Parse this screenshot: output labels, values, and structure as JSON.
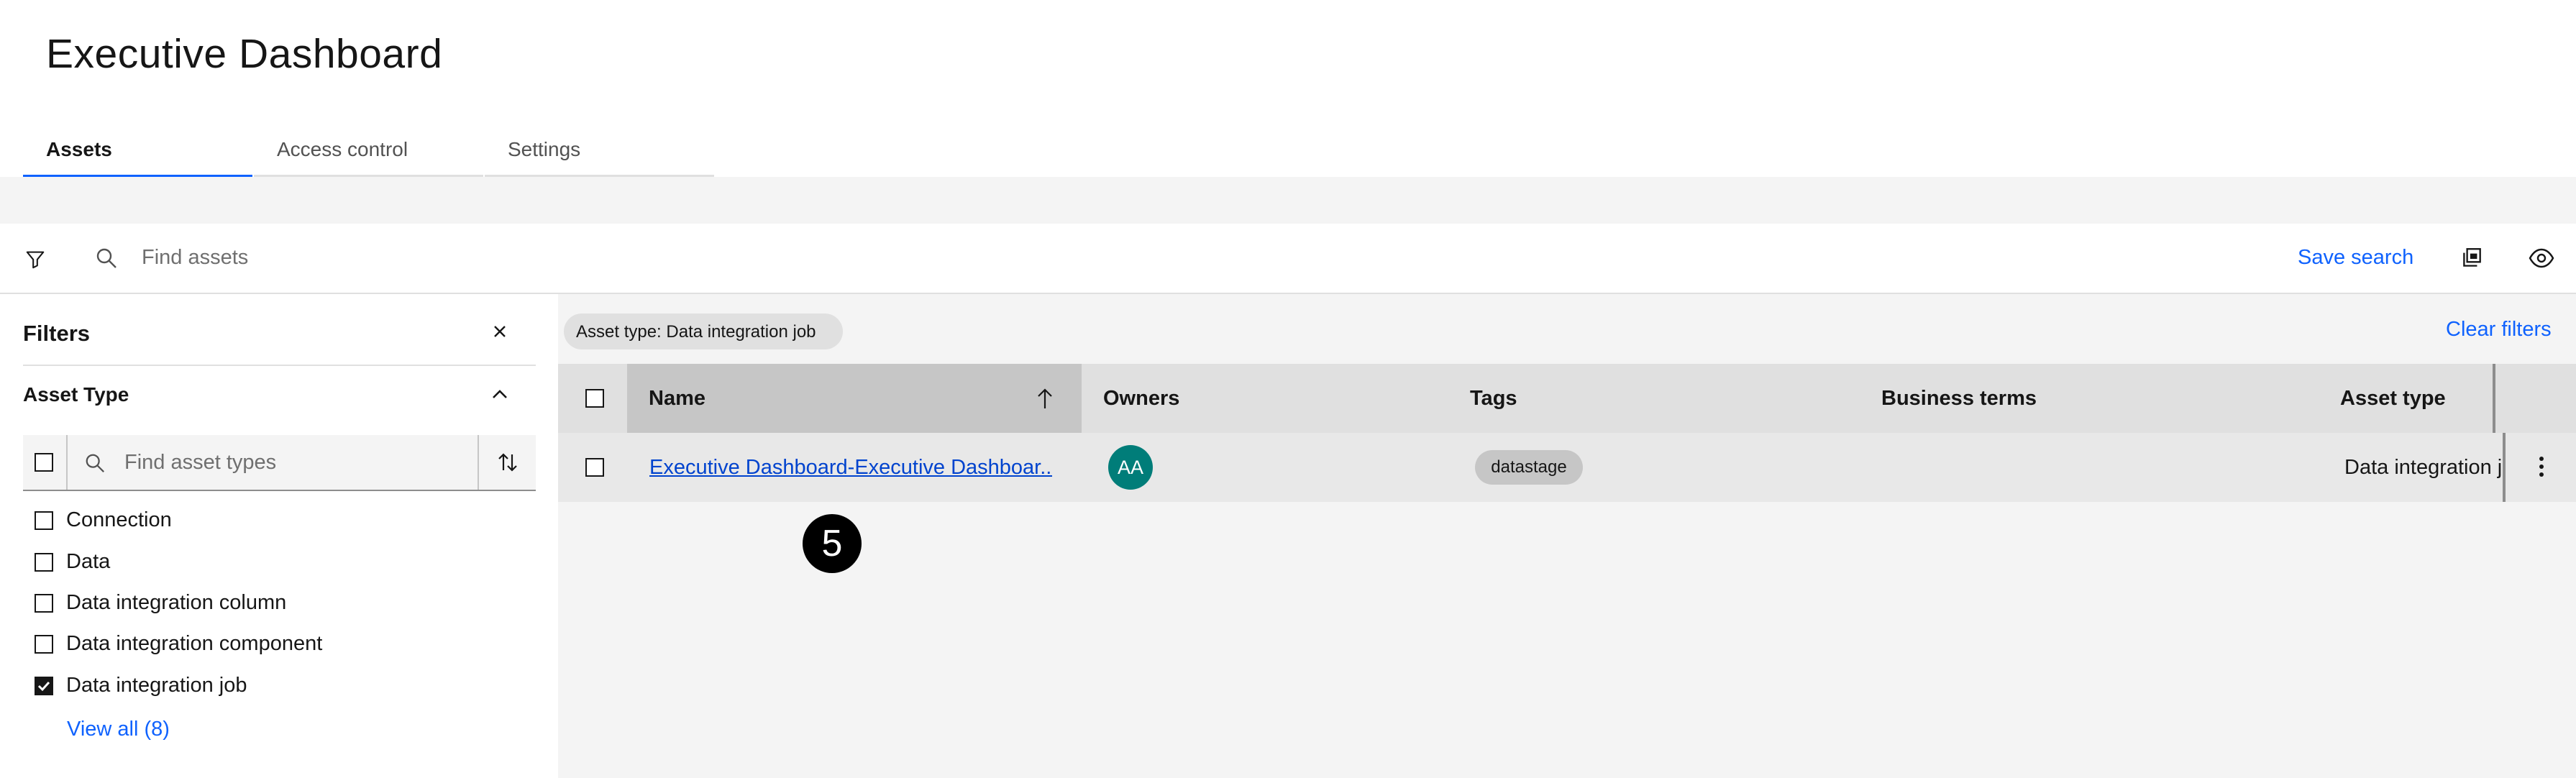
{
  "page": {
    "title": "Executive Dashboard"
  },
  "tabs": [
    {
      "label": "Assets",
      "active": true
    },
    {
      "label": "Access control",
      "active": false
    },
    {
      "label": "Settings",
      "active": false
    }
  ],
  "toolbar": {
    "filter_icon": "filter-icon",
    "search_icon": "search-icon",
    "search_placeholder": "Find assets",
    "save_search_label": "Save search",
    "saved_searches_icon": "saved-searches-icon",
    "view_icon": "eye-icon"
  },
  "filters_panel": {
    "title": "Filters",
    "close_icon": "close-icon",
    "section": {
      "title": "Asset Type",
      "expanded": true,
      "search_placeholder": "Find asset types",
      "options": [
        {
          "label": "Connection",
          "checked": false
        },
        {
          "label": "Data",
          "checked": false
        },
        {
          "label": "Data integration column",
          "checked": false
        },
        {
          "label": "Data integration component",
          "checked": false
        },
        {
          "label": "Data integration job",
          "checked": true
        }
      ],
      "view_all_label": "View all (8)"
    }
  },
  "active_filters": {
    "chips": [
      "Asset type: Data integration job"
    ],
    "clear_label": "Clear filters"
  },
  "table": {
    "columns": [
      "Name",
      "Owners",
      "Tags",
      "Business terms",
      "Asset type"
    ],
    "sort": {
      "column": "Name",
      "direction": "ascending"
    },
    "rows": [
      {
        "name": "Executive Dashboard-Executive Dashboar...",
        "owner_initials": "AA",
        "tags": [
          "datastage"
        ],
        "business_terms": "",
        "asset_type": "Data integration job"
      }
    ]
  },
  "annotation": {
    "step_number": "5"
  },
  "colors": {
    "accent": "#0f62fe",
    "link": "#0043ce",
    "avatar": "#007d79",
    "panel_bg": "#f4f4f4"
  }
}
